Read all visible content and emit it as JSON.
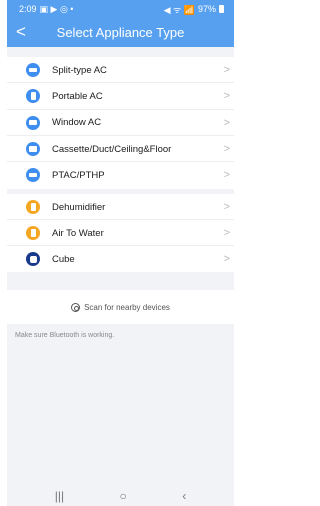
{
  "status_bar": {
    "time": "2:09",
    "left_icons": "▣ ▶ ◎ •",
    "right_icons": "◀ ᯤ 📶",
    "battery": "97%"
  },
  "header": {
    "title": "Select Appliance Type",
    "back_icon": "chevron-left-icon"
  },
  "groups": [
    {
      "items": [
        {
          "label": "Split-type AC",
          "icon": "split-ac-icon",
          "color": "#3e8ef0"
        },
        {
          "label": "Portable AC",
          "icon": "portable-ac-icon",
          "color": "#3e8ef0"
        },
        {
          "label": "Window AC",
          "icon": "window-ac-icon",
          "color": "#3e8ef0"
        },
        {
          "label": "Cassette/Duct/Ceiling&Floor",
          "icon": "cassette-icon",
          "color": "#3e8ef0"
        },
        {
          "label": "PTAC/PTHP",
          "icon": "ptac-icon",
          "color": "#3e8ef0"
        }
      ]
    },
    {
      "items": [
        {
          "label": "Dehumidifier",
          "icon": "dehumidifier-icon",
          "color": "#f5a623"
        },
        {
          "label": "Air To Water",
          "icon": "air-to-water-icon",
          "color": "#f5a623"
        },
        {
          "label": "Cube",
          "icon": "cube-icon",
          "color": "#173a8a"
        }
      ]
    }
  ],
  "scan": {
    "label": "Scan for nearby devices"
  },
  "hint": "Make sure Bluetooth is working.",
  "navbar": {
    "recents": "|||",
    "home": "○",
    "back": "‹"
  }
}
